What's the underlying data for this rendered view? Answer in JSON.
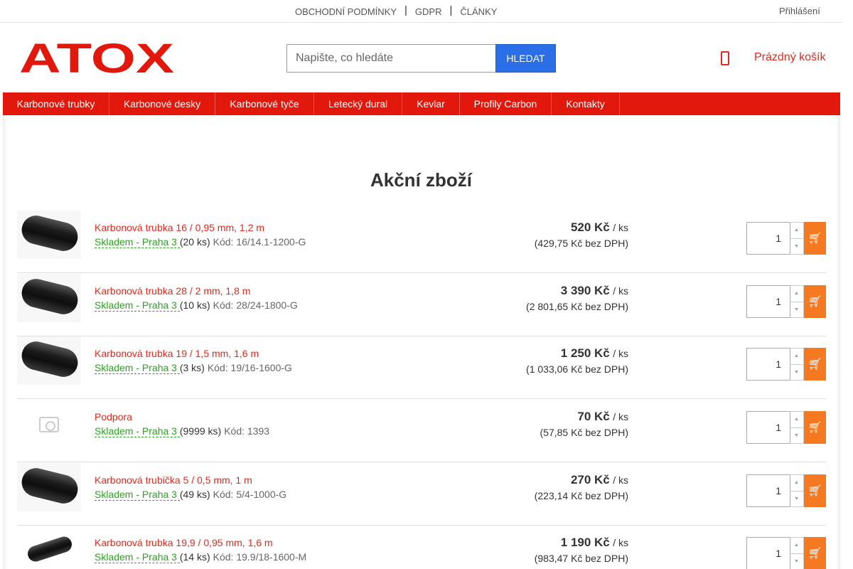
{
  "topbar": {
    "links": [
      "OBCHODNÍ PODMÍNKY",
      "GDPR",
      "ČLÁNKY"
    ],
    "separator": "|",
    "login": "Přihlášení"
  },
  "logo": {
    "text": "ATOX",
    "color": "#e3180c"
  },
  "search": {
    "placeholder": "Napište, co hledáte",
    "button": "HLEDAT"
  },
  "cart": {
    "label": "Prázdný košík",
    "icon": "cart-icon"
  },
  "nav": [
    "Karbonové trubky",
    "Karbonové desky",
    "Karbonové tyče",
    "Letecký dural",
    "Kevlar",
    "Profily Carbon",
    "Kontakty"
  ],
  "page": {
    "title": "Akční zboží"
  },
  "products": [
    {
      "name": "Karbonová trubka 16 / 0,95 mm, 1,2 m",
      "availability": "Skladem - Praha 3 ",
      "count": "(20 ks)",
      "code": "Kód: 16/14.1-1200-G",
      "price": "520 Kč",
      "unit": "/ ks",
      "price_net": "(429,75 Kč bez DPH)",
      "qty": "1",
      "image": "carbon-tube"
    },
    {
      "name": "Karbonová trubka 28 / 2 mm, 1,8 m",
      "availability": "Skladem - Praha 3 ",
      "count": "(10 ks)",
      "code": "Kód: 28/24-1800-G",
      "price": "3 390 Kč",
      "unit": "/ ks",
      "price_net": "(2 801,65 Kč bez DPH)",
      "qty": "1",
      "image": "carbon-tube"
    },
    {
      "name": "Karbonová trubka 19 / 1,5 mm, 1,6 m",
      "availability": "Skladem - Praha 3 ",
      "count": "(3 ks)",
      "code": "Kód: 19/16-1600-G",
      "price": "1 250 Kč",
      "unit": "/ ks",
      "price_net": "(1 033,06 Kč bez DPH)",
      "qty": "1",
      "image": "carbon-tube"
    },
    {
      "name": "Podpora",
      "availability": "Skladem - Praha 3 ",
      "count": "(9999 ks)",
      "code": "Kód: 1393",
      "price": "70 Kč",
      "unit": "/ ks",
      "price_net": "(57,85 Kč bez DPH)",
      "qty": "1",
      "image": "no-image"
    },
    {
      "name": "Karbonová trubička 5 / 0,5 mm, 1 m",
      "availability": "Skladem - Praha 3 ",
      "count": "(49 ks)",
      "code": "Kód: 5/4-1000-G",
      "price": "270 Kč",
      "unit": "/ ks",
      "price_net": "(223,14 Kč bez DPH)",
      "qty": "1",
      "image": "carbon-tube"
    },
    {
      "name": "Karbonová trubka 19,9 / 0,95 mm, 1,6 m",
      "availability": "Skladem - Praha 3 ",
      "count": "(14 ks)",
      "code": "Kód: 19.9/18-1600-M",
      "price": "1 190 Kč",
      "unit": "/ ks",
      "price_net": "(983,47 Kč bez DPH)",
      "qty": "1",
      "image": "carbon-tube-small"
    }
  ],
  "colors": {
    "accent": "#e3180c",
    "link": "#e02a1e",
    "stock": "#27a51c",
    "buy": "#f47920",
    "search_button": "#2a6ee8"
  }
}
